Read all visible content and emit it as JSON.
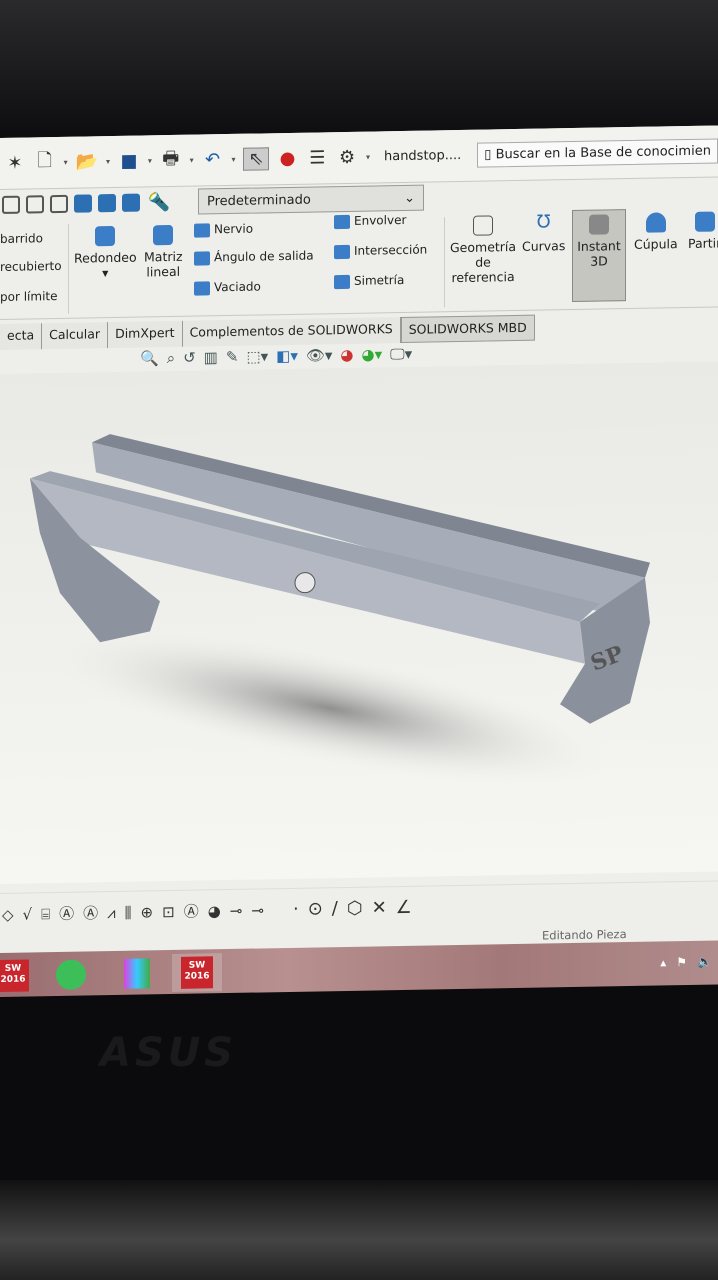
{
  "titlebar": {
    "document_title": "handstop....",
    "search_placeholder": "Buscar en la Base de conocimien"
  },
  "config_dropdown": {
    "value": "Predeterminado"
  },
  "ribbon": {
    "left_items": [
      "barrido",
      "recubierto",
      "por límite"
    ],
    "redondeo": "Redondeo",
    "matriz": [
      "Matriz",
      "lineal"
    ],
    "nervio": "Nervio",
    "angulo": "Ángulo de salida",
    "vaciado": "Vaciado",
    "envolver": "Envolver",
    "interseccion": "Intersección",
    "simetria": "Simetría",
    "geometria": [
      "Geometría",
      "de",
      "referencia"
    ],
    "curvas": "Curvas",
    "instant3d": [
      "Instant",
      "3D"
    ],
    "cupula": "Cúpula",
    "partir": "Partir"
  },
  "tabs": [
    "ecta",
    "Calcular",
    "DimXpert",
    "Complementos de SOLIDWORKS",
    "SOLIDWORKS MBD"
  ],
  "status": {
    "text": "Editando Pieza"
  },
  "model": {
    "engraving": "SP"
  },
  "taskbar": {
    "sw_label": [
      "SW",
      "2016"
    ]
  },
  "brand": {
    "laptop_logo": "ASUS"
  }
}
